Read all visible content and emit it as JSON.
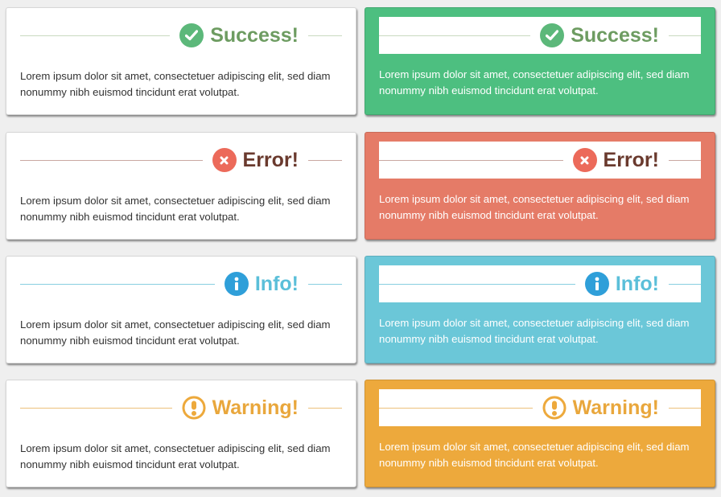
{
  "body_text": "Lorem ipsum dolor sit amet, consectetuer adipiscing elit, sed diam nonummy nibh euismod tincidunt erat volutpat.",
  "alerts": [
    {
      "type": "success",
      "title": "Success!",
      "icon": "check-circle-icon",
      "accent": "#6d9c61",
      "rule": "#c8d9c0",
      "fill": "#4dbf80",
      "badge": "#5cb87a"
    },
    {
      "type": "error",
      "title": "Error!",
      "icon": "x-circle-icon",
      "accent": "#6a3a2e",
      "rule": "#c9a8a2",
      "fill": "#e57b67",
      "badge": "#ec6a5a"
    },
    {
      "type": "info",
      "title": "Info!",
      "icon": "info-circle-icon",
      "accent": "#5bbfd9",
      "rule": "#88cfe0",
      "fill": "#6bc7d8",
      "badge": "#2f9fd9"
    },
    {
      "type": "warning",
      "title": "Warning!",
      "icon": "exclamation-circle-icon",
      "accent": "#e9a73c",
      "rule": "#ecc07a",
      "fill": "#eda93c",
      "badge": "#eda93c"
    }
  ]
}
